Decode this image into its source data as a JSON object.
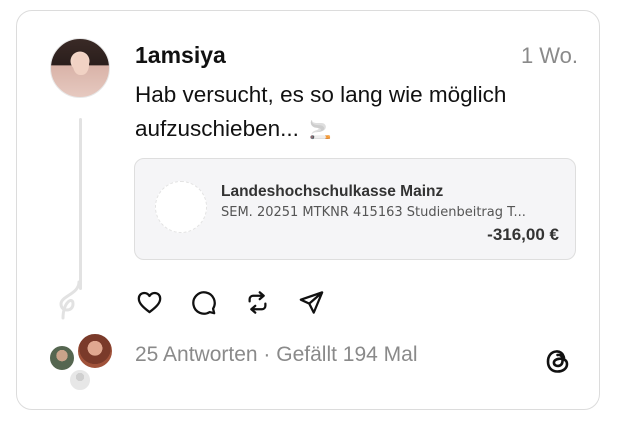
{
  "post": {
    "username": "1amsiya",
    "time": "1 Wo.",
    "text": "Hab versucht, es so lang wie möglich aufzuschieben...",
    "emoji": "🚬"
  },
  "transaction": {
    "payee": "Landeshochschulkasse Mainz",
    "reference": "SEM. 20251 MTKNR 415163 Studienbeitrag T...",
    "amount": "-316,00 €"
  },
  "actions": {
    "icons": [
      "heart-icon",
      "comment-icon",
      "repost-icon",
      "share-icon"
    ]
  },
  "footer": {
    "replies": "25 Antworten",
    "separator": " · ",
    "likes": "Gefällt 194 Mal"
  },
  "colors": {
    "text": "#111111",
    "muted": "#8a8a8a",
    "border": "#dcdcdc",
    "card_bg": "#f5f5f7"
  }
}
